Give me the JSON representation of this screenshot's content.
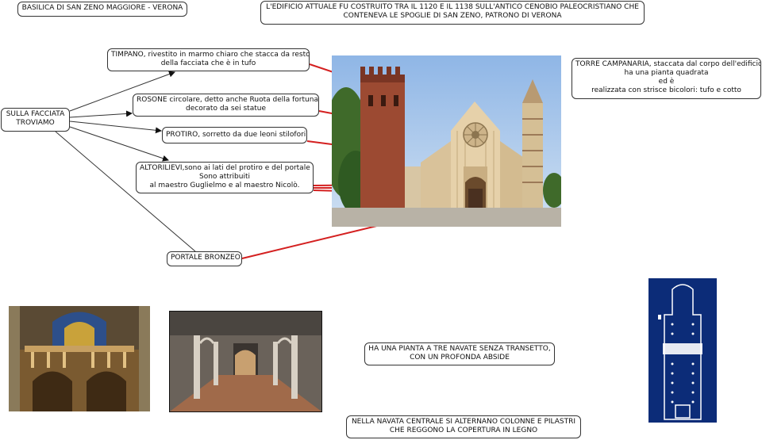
{
  "nodes": {
    "title": "BASILICA DI SAN ZENO MAGGIORE - VERONA",
    "history": [
      "L'EDIFICIO ATTUALE FU COSTRUITO TRA IL 1120 E IL 1138 SULL'ANTICO CENOBIO PALEOCRISTIANO CHE",
      "CONTENEVA LE SPOGLIE DI SAN ZENO, PATRONO DI VERONA"
    ],
    "facade": [
      "SULLA FACCIATA",
      "TROVIAMO"
    ],
    "tympanum": [
      "TIMPANO, rivestito in marmo chiaro che stacca da resto",
      "della facciata che è in tufo"
    ],
    "rose_window": [
      "ROSONE circolare, detto anche Ruota della fortuna,",
      "decorato da sei statue"
    ],
    "portico": [
      "PROTIRO, sorretto da due leoni stilofori"
    ],
    "reliefs": [
      "ALTORILIEVI,sono ai lati del protiro e del portale",
      "Sono attribuiti",
      "al maestro Guglielmo e al maestro Nicolò."
    ],
    "bronze_door": [
      "PORTALE BRONZEO"
    ],
    "bell_tower": [
      "TORRE CAMPANARIA, staccata dal corpo dell'edificio",
      "ha una pianta quadrata",
      "ed è",
      "realizzata con strisce bicolori: tufo e cotto"
    ],
    "plan": [
      "HA UNA PIANTA A TRE NAVATE SENZA TRANSETTO,",
      "CON UN PROFONDA  ABSIDE"
    ],
    "nave": [
      "NELLA NAVATA CENTRALE SI ALTERNANO COLONNE E  PILASTRI",
      "CHE REGGONO LA COPERTURA IN LEGNO"
    ]
  },
  "colors": {
    "connector": "#333333",
    "pointer": "#d42020",
    "plan_background": "#0c2c78",
    "plan_lines": "#ffffff"
  }
}
